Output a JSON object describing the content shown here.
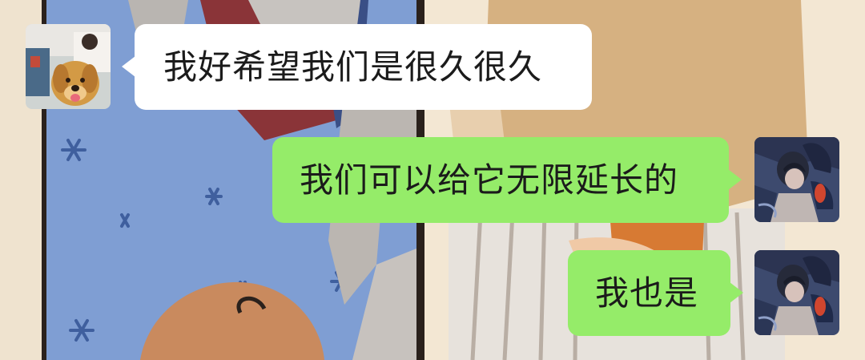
{
  "conversation": {
    "messages": [
      {
        "side": "left",
        "sender": "friend",
        "text": "我好希望我们是很久很久"
      },
      {
        "side": "right",
        "sender": "me",
        "text": "我们可以给它无限延长的"
      },
      {
        "side": "right",
        "sender": "me",
        "text": "我也是"
      }
    ]
  },
  "colors": {
    "incoming_bubble": "#ffffff",
    "outgoing_bubble": "#95ec69",
    "text": "#1b1b1b"
  },
  "icons": {
    "friend_avatar": "golden-retriever-photo-avatar",
    "my_avatar": "dark-anime-character-avatar"
  }
}
